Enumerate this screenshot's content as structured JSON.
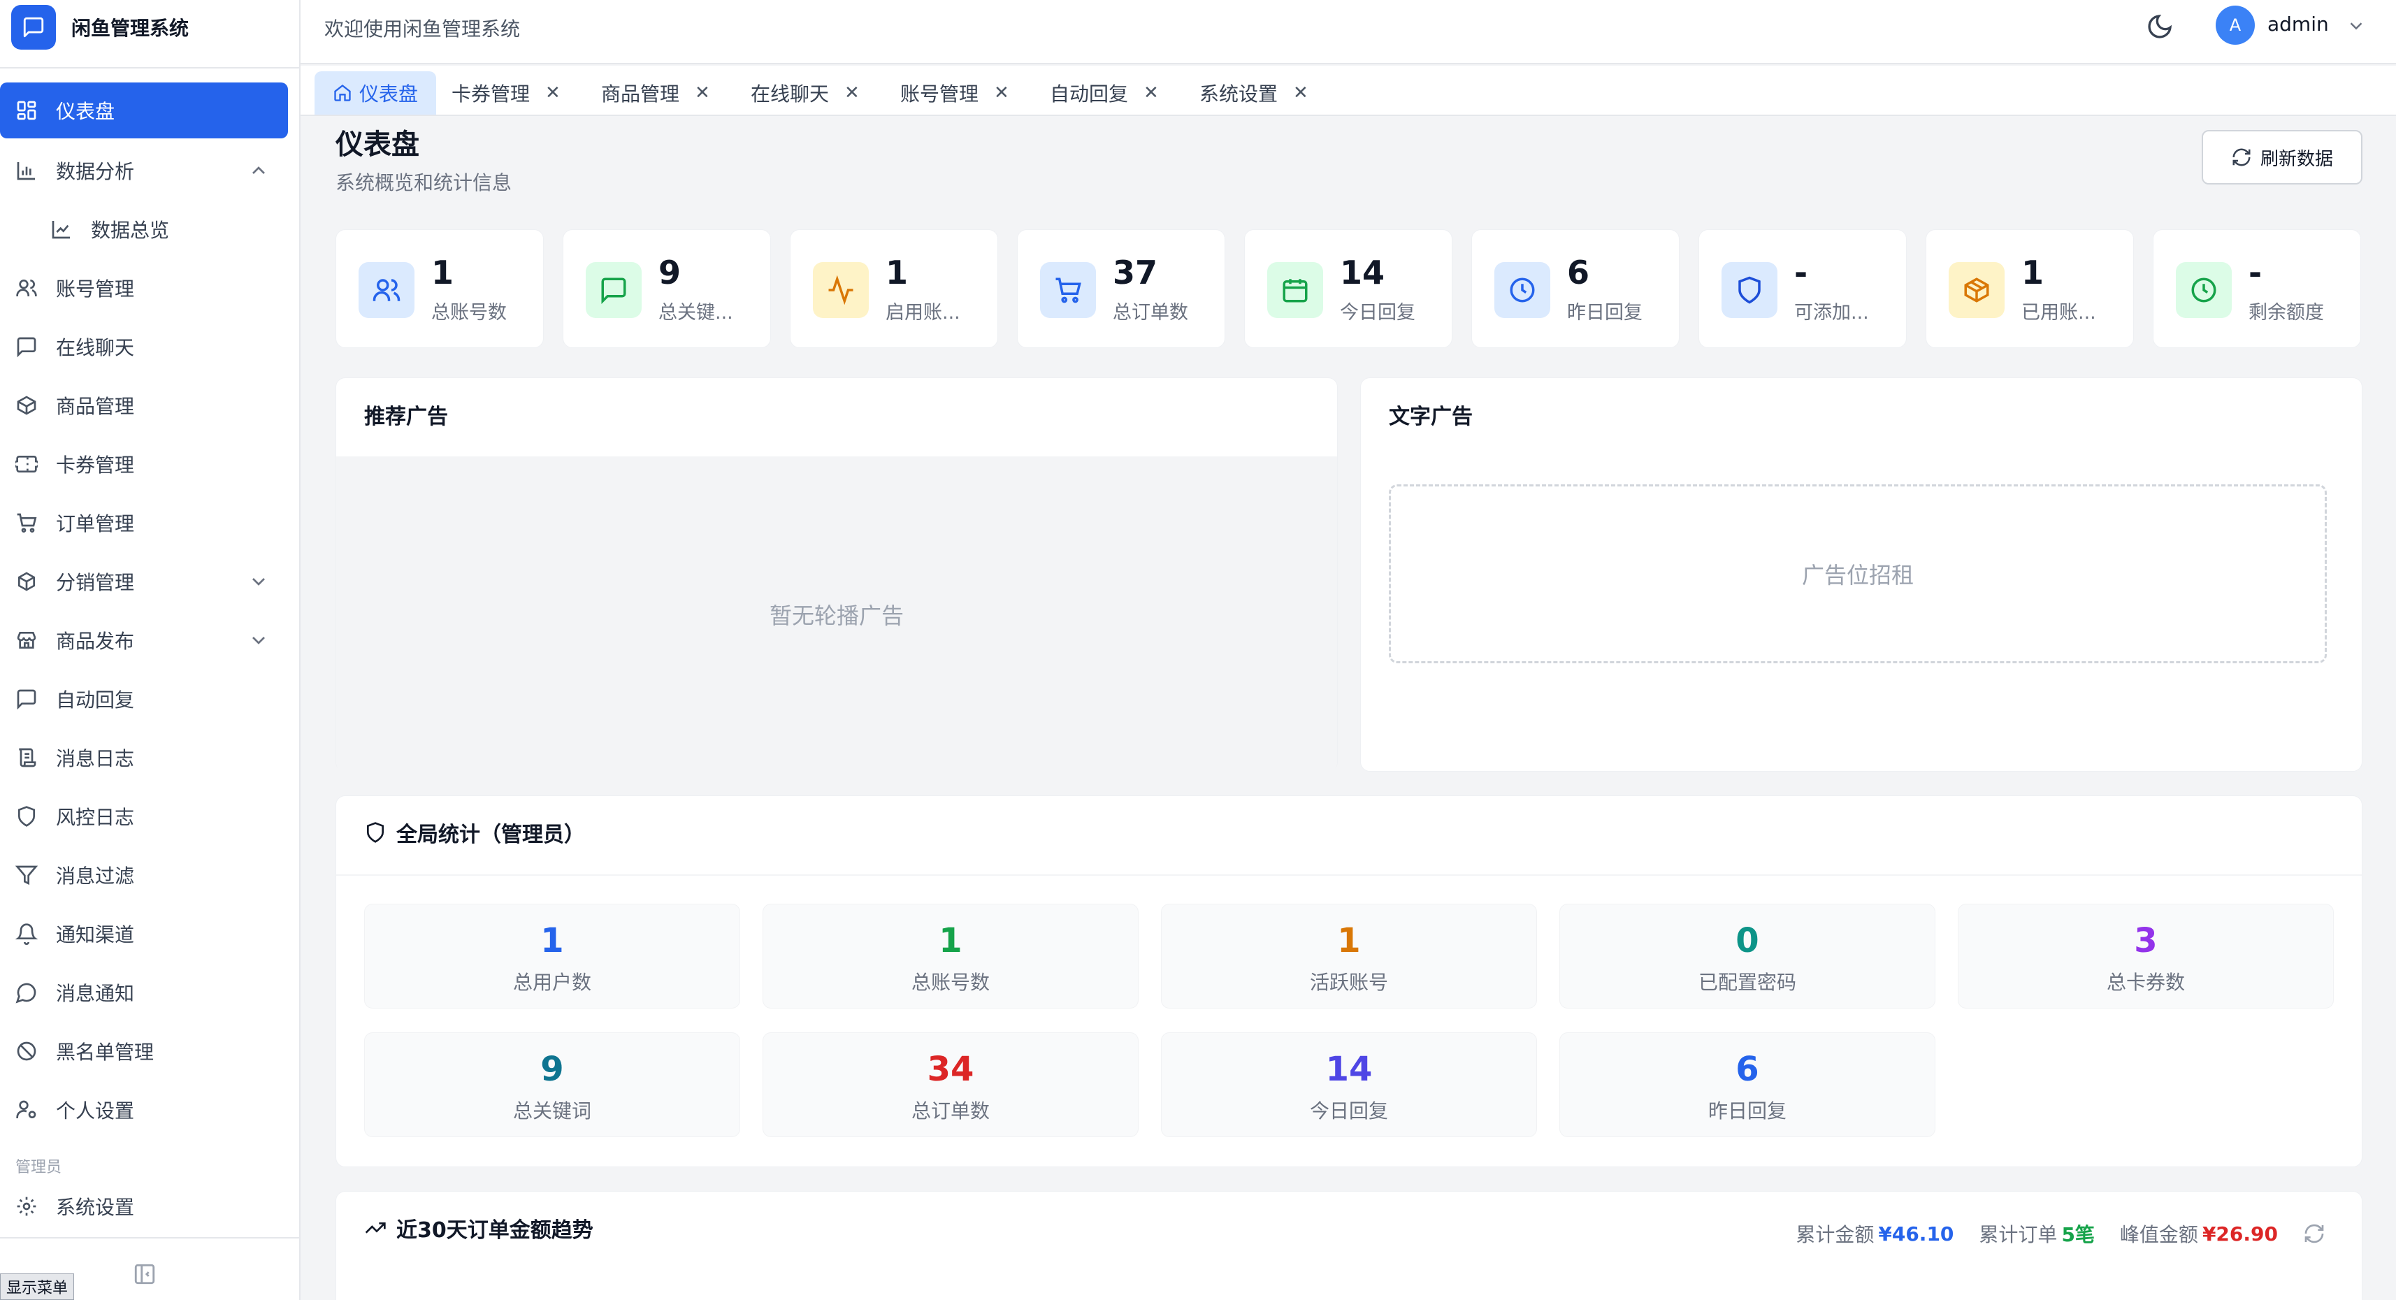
{
  "app": {
    "title": "闲鱼管理系统"
  },
  "header": {
    "welcome": "欢迎使用闲鱼管理系统",
    "avatar_letter": "A",
    "username": "admin"
  },
  "sidebar": {
    "items": [
      {
        "label": "仪表盘",
        "icon": "dashboard-icon",
        "active": true
      },
      {
        "label": "数据分析",
        "icon": "bar-chart-icon",
        "expanded": true
      },
      {
        "label": "数据总览",
        "icon": "line-chart-icon",
        "sub": true
      },
      {
        "label": "账号管理",
        "icon": "users-icon"
      },
      {
        "label": "在线聊天",
        "icon": "message-icon"
      },
      {
        "label": "商品管理",
        "icon": "package-icon"
      },
      {
        "label": "卡券管理",
        "icon": "ticket-icon"
      },
      {
        "label": "订单管理",
        "icon": "cart-icon"
      },
      {
        "label": "分销管理",
        "icon": "boxes-icon",
        "collapsed": true
      },
      {
        "label": "商品发布",
        "icon": "store-icon",
        "collapsed": true
      },
      {
        "label": "自动回复",
        "icon": "message-icon"
      },
      {
        "label": "消息日志",
        "icon": "scroll-icon"
      },
      {
        "label": "风控日志",
        "icon": "shield-icon"
      },
      {
        "label": "消息过滤",
        "icon": "filter-icon"
      },
      {
        "label": "通知渠道",
        "icon": "bell-icon"
      },
      {
        "label": "消息通知",
        "icon": "chat-circle-icon"
      },
      {
        "label": "黑名单管理",
        "icon": "ban-icon"
      },
      {
        "label": "个人设置",
        "icon": "user-cog-icon"
      }
    ],
    "admin_section_label": "管理员",
    "admin_items": [
      {
        "label": "系统设置",
        "icon": "gear-icon"
      }
    ],
    "tooltip": "显示菜单"
  },
  "tabs": [
    {
      "label": "仪表盘",
      "active": true
    },
    {
      "label": "卡券管理"
    },
    {
      "label": "商品管理"
    },
    {
      "label": "在线聊天"
    },
    {
      "label": "账号管理"
    },
    {
      "label": "自动回复"
    },
    {
      "label": "系统设置"
    }
  ],
  "page": {
    "title": "仪表盘",
    "subtitle": "系统概览和统计信息",
    "refresh_label": "刷新数据"
  },
  "stats": [
    {
      "value": "1",
      "label": "总账号数",
      "icon": "users-icon",
      "color": "#2563eb",
      "bg": "#dbeafe"
    },
    {
      "value": "9",
      "label": "总关键...",
      "icon": "message-icon",
      "color": "#16a34a",
      "bg": "#dcfce7"
    },
    {
      "value": "1",
      "label": "启用账...",
      "icon": "activity-icon",
      "color": "#d97706",
      "bg": "#fef3c7"
    },
    {
      "value": "37",
      "label": "总订单数",
      "icon": "cart-icon",
      "color": "#2563eb",
      "bg": "#dbeafe"
    },
    {
      "value": "14",
      "label": "今日回复",
      "icon": "calendar-icon",
      "color": "#16a34a",
      "bg": "#dcfce7"
    },
    {
      "value": "6",
      "label": "昨日回复",
      "icon": "clock-icon",
      "color": "#2563eb",
      "bg": "#dbeafe"
    },
    {
      "value": "-",
      "label": "可添加...",
      "icon": "shield-icon",
      "color": "#1d4ed8",
      "bg": "#dbeafe"
    },
    {
      "value": "1",
      "label": "已用账...",
      "icon": "package-icon",
      "color": "#d97706",
      "bg": "#fef3c7"
    },
    {
      "value": "-",
      "label": "剩余额度",
      "icon": "clock-icon",
      "color": "#16a34a",
      "bg": "#dcfce7"
    }
  ],
  "ads": {
    "recommend_title": "推荐广告",
    "recommend_empty": "暂无轮播广告",
    "text_title": "文字广告",
    "text_placeholder": "广告位招租"
  },
  "global_stats": {
    "title": "全局统计（管理员）",
    "items": [
      {
        "value": "1",
        "label": "总用户数",
        "color": "#2563eb"
      },
      {
        "value": "1",
        "label": "总账号数",
        "color": "#16a34a"
      },
      {
        "value": "1",
        "label": "活跃账号",
        "color": "#d97706"
      },
      {
        "value": "0",
        "label": "已配置密码",
        "color": "#0d9488"
      },
      {
        "value": "3",
        "label": "总卡券数",
        "color": "#9333ea"
      },
      {
        "value": "9",
        "label": "总关键词",
        "color": "#0e7490"
      },
      {
        "value": "34",
        "label": "总订单数",
        "color": "#dc2626"
      },
      {
        "value": "14",
        "label": "今日回复",
        "color": "#4f46e5"
      },
      {
        "value": "6",
        "label": "昨日回复",
        "color": "#2563eb"
      }
    ]
  },
  "trend": {
    "title": "近30天订单金额趋势",
    "total_amount_label": "累计金额",
    "total_amount": "¥46.10",
    "total_amount_color": "#2563eb",
    "total_orders_label": "累计订单",
    "total_orders": "5笔",
    "total_orders_color": "#16a34a",
    "peak_label": "峰值金额",
    "peak": "¥26.90",
    "peak_color": "#dc2626"
  }
}
